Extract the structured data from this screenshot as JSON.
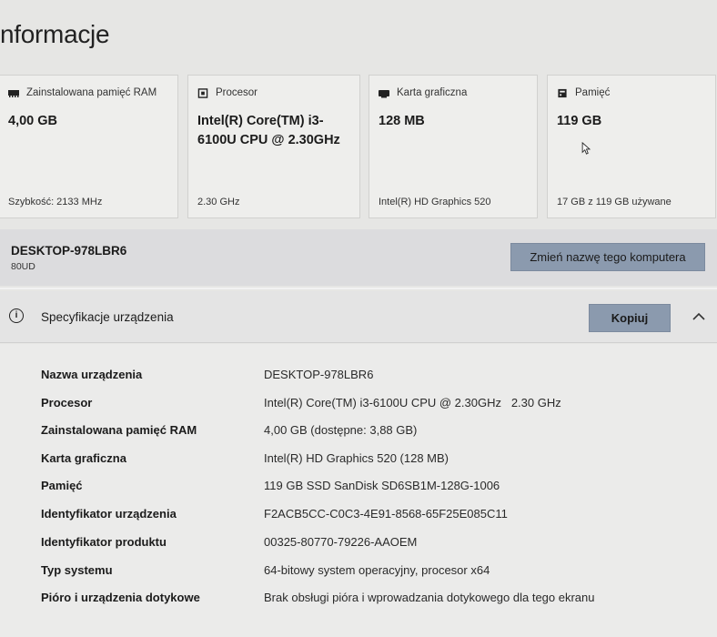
{
  "page": {
    "title": "nformacje"
  },
  "cards": [
    {
      "icon": "memory-icon",
      "label": "Zainstalowana pamięć RAM",
      "value": "4,00 GB",
      "footer": "Szybkość: 2133 MHz"
    },
    {
      "icon": "processor-icon",
      "label": "Procesor",
      "value": "Intel(R) Core(TM) i3-6100U CPU @ 2.30GHz",
      "footer": "2.30 GHz"
    },
    {
      "icon": "graphics-card-icon",
      "label": "Karta graficzna",
      "value": "128 MB",
      "footer": "Intel(R) HD Graphics 520"
    },
    {
      "icon": "storage-icon",
      "label": "Pamięć",
      "value": "119 GB",
      "footer": "17 GB z 119 GB używane"
    }
  ],
  "computer": {
    "name": "DESKTOP-978LBR6",
    "model": "80UD",
    "rename_label": "Zmień nazwę tego komputera"
  },
  "specs": {
    "title": "Specyfikacje urządzenia",
    "copy_label": "Kopiuj",
    "rows": [
      {
        "label": "Nazwa urządzenia",
        "value": "DESKTOP-978LBR6"
      },
      {
        "label": "Procesor",
        "value": "Intel(R) Core(TM) i3-6100U CPU @ 2.30GHz   2.30 GHz"
      },
      {
        "label": "Zainstalowana pamięć RAM",
        "value": "4,00 GB (dostępne: 3,88 GB)"
      },
      {
        "label": "Karta graficzna",
        "value": "Intel(R) HD Graphics 520 (128 MB)"
      },
      {
        "label": "Pamięć",
        "value": "119 GB SSD SanDisk SD6SB1M-128G-1006"
      },
      {
        "label": "Identyfikator urządzenia",
        "value": "F2ACB5CC-C0C3-4E91-8568-65F25E085C11"
      },
      {
        "label": "Identyfikator produktu",
        "value": "00325-80770-79226-AAOEM"
      },
      {
        "label": "Typ systemu",
        "value": "64-bitowy system operacyjny, procesor x64"
      },
      {
        "label": "Pióro i urządzenia dotykowe",
        "value": "Brak obsługi pióra i wprowadzania dotykowego dla tego ekranu"
      }
    ]
  }
}
